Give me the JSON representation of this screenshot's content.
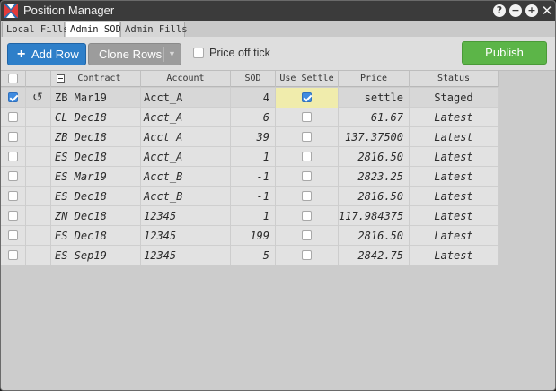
{
  "window": {
    "title": "Position Manager",
    "controls": {
      "help": "?",
      "minimize": "−",
      "maximize": "+",
      "close": "✕"
    }
  },
  "tabs": [
    {
      "label": "Local Fills",
      "active": false
    },
    {
      "label": "Admin SOD",
      "active": true
    },
    {
      "label": "Admin Fills",
      "active": false
    }
  ],
  "toolbar": {
    "add_row_label": "Add Row",
    "clone_rows_label": "Clone Rows",
    "price_off_tick_label": "Price off tick",
    "price_off_tick_checked": false,
    "publish_label": "Publish"
  },
  "colors": {
    "add_button": "#2e7fc9",
    "publish_button": "#5cb548",
    "clone_button": "#9c9c9c",
    "title_bar": "#3b3b3b",
    "use_settle_highlight": "#f0ecac",
    "checkbox_checked": "#3f8be0"
  },
  "table": {
    "columns": [
      "Contract",
      "Account",
      "SOD",
      "Use Settle",
      "Price",
      "Status"
    ],
    "rows": [
      {
        "selected": true,
        "undo": true,
        "contract": "ZB Mar19",
        "account": "Acct_A",
        "sod": "4",
        "use_settle": true,
        "price": "settle",
        "status": "Staged"
      },
      {
        "selected": false,
        "undo": false,
        "contract": "CL Dec18",
        "account": "Acct_A",
        "sod": "6",
        "use_settle": false,
        "price": "61.67",
        "status": "Latest"
      },
      {
        "selected": false,
        "undo": false,
        "contract": "ZB Dec18",
        "account": "Acct_A",
        "sod": "39",
        "use_settle": false,
        "price": "137.37500",
        "status": "Latest"
      },
      {
        "selected": false,
        "undo": false,
        "contract": "ES Dec18",
        "account": "Acct_A",
        "sod": "1",
        "use_settle": false,
        "price": "2816.50",
        "status": "Latest"
      },
      {
        "selected": false,
        "undo": false,
        "contract": "ES Mar19",
        "account": "Acct_B",
        "sod": "-1",
        "use_settle": false,
        "price": "2823.25",
        "status": "Latest"
      },
      {
        "selected": false,
        "undo": false,
        "contract": "ES Dec18",
        "account": "Acct_B",
        "sod": "-1",
        "use_settle": false,
        "price": "2816.50",
        "status": "Latest"
      },
      {
        "selected": false,
        "undo": false,
        "contract": "ZN Dec18",
        "account": "12345",
        "sod": "1",
        "use_settle": false,
        "price": "117.984375",
        "status": "Latest"
      },
      {
        "selected": false,
        "undo": false,
        "contract": "ES Dec18",
        "account": "12345",
        "sod": "199",
        "use_settle": false,
        "price": "2816.50",
        "status": "Latest"
      },
      {
        "selected": false,
        "undo": false,
        "contract": "ES Sep19",
        "account": "12345",
        "sod": "5",
        "use_settle": false,
        "price": "2842.75",
        "status": "Latest"
      }
    ]
  }
}
